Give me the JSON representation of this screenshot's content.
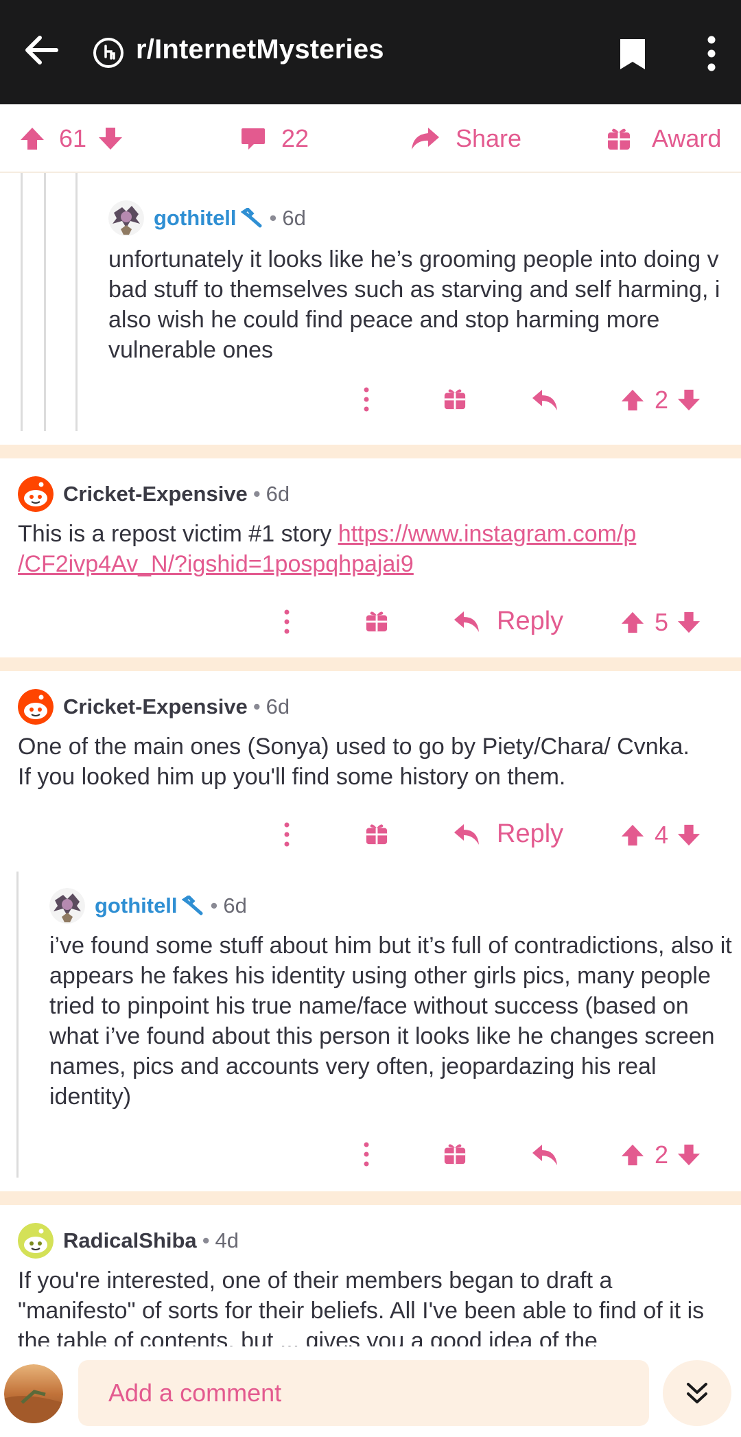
{
  "appbar": {
    "title": "r/InternetMysteries",
    "icons": [
      "back-arrow-icon",
      "subreddit-icon",
      "bookmark-icon",
      "more-vertical-icon"
    ]
  },
  "post_actions": {
    "score": "61",
    "comments": "22",
    "share": "Share",
    "award": "Award"
  },
  "comments": [
    {
      "user": "gothitell",
      "age": "6d",
      "text": "unfortunately it looks like he’s grooming people into doing v bad stuff to themselves such as starving and self harming, i also wish he could find peace and stop harming more vulnerable ones",
      "score": "2"
    },
    {
      "user": "Cricket-Expensive",
      "age": "6d",
      "text": "This is a repost victim #1 story ",
      "link_line1": "https://www.instagram.com/p",
      "link_line2": "/CF2ivp4Av_N/?igshid=1pospqhpajai9",
      "reply": "Reply",
      "score": "5"
    },
    {
      "user": "Cricket-Expensive",
      "age": "6d",
      "text": "One of the main ones (Sonya) used to go by Piety/Chara/ Cvnka. If you looked him up you'll find some history on them.",
      "reply": "Reply",
      "score": "4"
    },
    {
      "user": "gothitell",
      "age": "6d",
      "text": "i’ve found some stuff about him but it’s full of contradictions, also it appears he fakes his identity using other girls pics, many people tried to pinpoint his true name/face without success (based on what i’ve found about this person it looks like he changes screen names, pics and accounts very often, jeopardazing his real identity)",
      "score": "2"
    },
    {
      "user": "RadicalShiba",
      "age": "4d",
      "text": "If you're interested, one of their members began to draft a \"manifesto\" of sorts for their beliefs. All I've been able to find of it is the table of contents, but ... gives you a good idea of the"
    }
  ],
  "bottom": {
    "placeholder": "Add a comment"
  },
  "colors": {
    "accent": "#e35a8f",
    "band": "#fdecd9",
    "appbar": "#1a1a1b",
    "username_mod": "#2f8fd3"
  }
}
